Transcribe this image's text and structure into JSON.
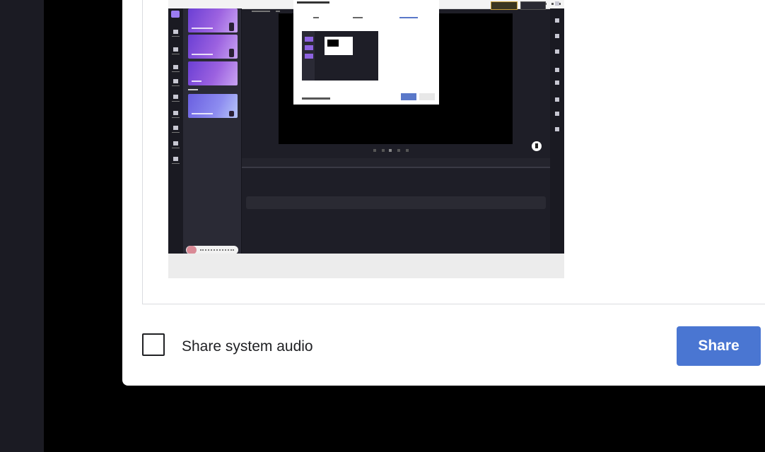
{
  "dialog": {
    "share_audio_label": "Share system audio",
    "share_audio_checked": false,
    "share_button_label": "Share"
  },
  "colors": {
    "share_button": "#4a76d2",
    "page_background": "#000000",
    "app_sidebar": "#1b1b23",
    "dialog_background": "#ffffff"
  }
}
